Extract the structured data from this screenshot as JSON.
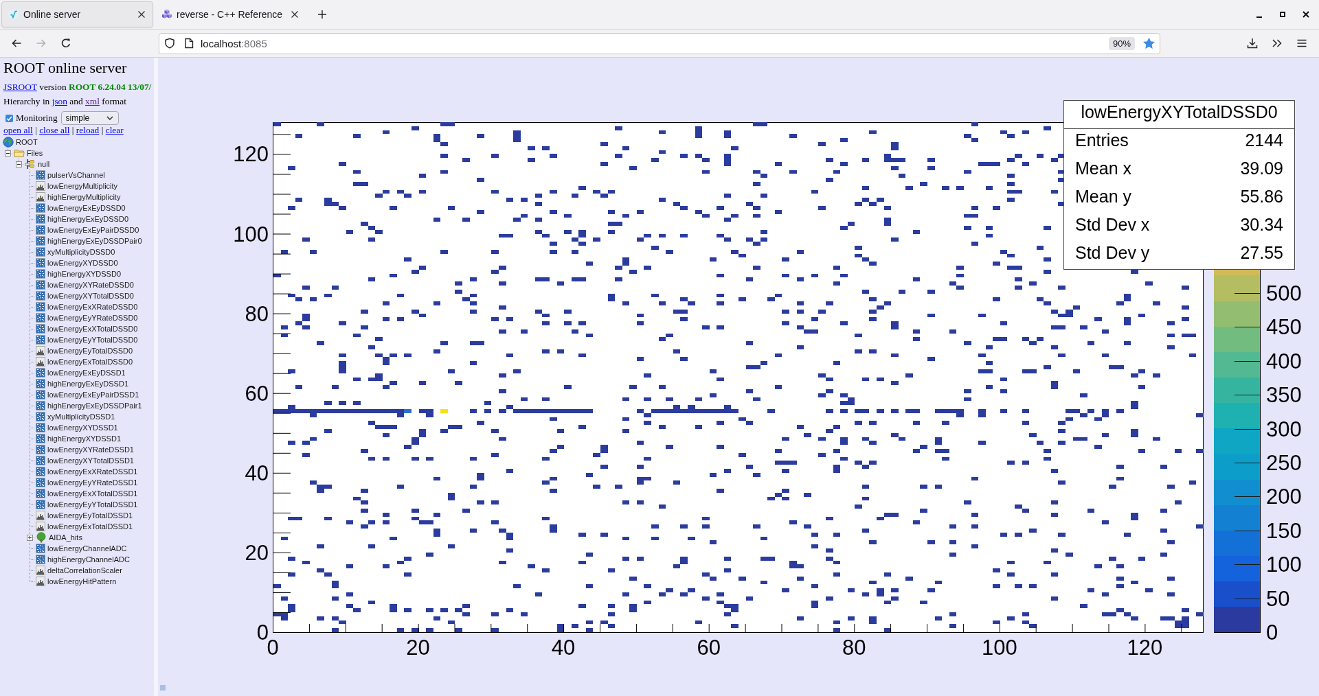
{
  "browser": {
    "tabs": [
      {
        "title": "Online server",
        "selected": true
      },
      {
        "title": "reverse - C++ Reference",
        "selected": false
      }
    ],
    "nav_buttons": [
      {
        "kind": "back",
        "disabled": false
      },
      {
        "kind": "forward",
        "disabled": true
      },
      {
        "kind": "reload",
        "disabled": false
      }
    ],
    "address_bar": {
      "host": "localhost",
      "port": ":8085",
      "zoom": "90%",
      "bookmarked": true
    }
  },
  "sidebar": {
    "title": "ROOT online server",
    "version_line": {
      "link": "JSROOT",
      "text": "version **ROOT 6.24.04 13/07/**"
    },
    "hierarchy_line": {
      "parts": [
        {
          "kind": "text",
          "text": "Hierarchy in"
        },
        {
          "kind": "link",
          "text": "json",
          "visited": false
        },
        {
          "kind": "text",
          "text": "and"
        },
        {
          "kind": "link",
          "text": "xml",
          "visited": true
        },
        {
          "kind": "text",
          "text": "format"
        }
      ]
    },
    "monitoring": {
      "label": "Monitoring",
      "checked": true,
      "mode": "simple"
    },
    "actions": {
      "links": [
        "open all",
        "close all",
        "reload",
        "clear"
      ],
      "separator": "|"
    },
    "tree": {
      "label": "ROOT",
      "kind": "root",
      "children": [
        {
          "label": "Files",
          "kind": "folder",
          "expanded": true,
          "children": [
            {
              "label": "null",
              "kind": "file",
              "expanded": true,
              "children": [
                {
                  "label": "pulserVsChannel",
                  "kind": "h2"
                },
                {
                  "label": "lowEnergyMultiplicity",
                  "kind": "h1"
                },
                {
                  "label": "highEnergyMultiplicity",
                  "kind": "h1"
                },
                {
                  "label": "lowEnergyExEyDSSD0",
                  "kind": "h2"
                },
                {
                  "label": "highEnergyExEyDSSD0",
                  "kind": "h2"
                },
                {
                  "label": "lowEnergyExEyPairDSSD0",
                  "kind": "h2"
                },
                {
                  "label": "highEnergyExEyDSSDPair0",
                  "kind": "h2"
                },
                {
                  "label": "xyMultiplicityDSSD0",
                  "kind": "h2"
                },
                {
                  "label": "lowEnergyXYDSSD0",
                  "kind": "h2"
                },
                {
                  "label": "highEnergyXYDSSD0",
                  "kind": "h2"
                },
                {
                  "label": "lowEnergyXYRateDSSD0",
                  "kind": "h2"
                },
                {
                  "label": "lowEnergyXYTotalDSSD0",
                  "kind": "h2"
                },
                {
                  "label": "lowEnergyExXRateDSSD0",
                  "kind": "h2"
                },
                {
                  "label": "lowEnergyEyYRateDSSD0",
                  "kind": "h2"
                },
                {
                  "label": "lowEnergyExXTotalDSSD0",
                  "kind": "h2"
                },
                {
                  "label": "lowEnergyEyYTotalDSSD0",
                  "kind": "h2"
                },
                {
                  "label": "lowEnergyEyTotalDSSD0",
                  "kind": "h1"
                },
                {
                  "label": "lowEnergyExTotalDSSD0",
                  "kind": "h1"
                },
                {
                  "label": "lowEnergyExEyDSSD1",
                  "kind": "h2"
                },
                {
                  "label": "highEnergyExEyDSSD1",
                  "kind": "h2"
                },
                {
                  "label": "lowEnergyExEyPairDSSD1",
                  "kind": "h2"
                },
                {
                  "label": "highEnergyExEyDSSDPair1",
                  "kind": "h2"
                },
                {
                  "label": "xyMultiplicityDSSD1",
                  "kind": "h2"
                },
                {
                  "label": "lowEnergyXYDSSD1",
                  "kind": "h2"
                },
                {
                  "label": "highEnergyXYDSSD1",
                  "kind": "h2"
                },
                {
                  "label": "lowEnergyXYRateDSSD1",
                  "kind": "h2"
                },
                {
                  "label": "lowEnergyXYTotalDSSD1",
                  "kind": "h2"
                },
                {
                  "label": "lowEnergyExXRateDSSD1",
                  "kind": "h2"
                },
                {
                  "label": "lowEnergyEyYRateDSSD1",
                  "kind": "h2"
                },
                {
                  "label": "lowEnergyExXTotalDSSD1",
                  "kind": "h2"
                },
                {
                  "label": "lowEnergyEyYTotalDSSD1",
                  "kind": "h2"
                },
                {
                  "label": "lowEnergyEyTotalDSSD1",
                  "kind": "h1"
                },
                {
                  "label": "lowEnergyExTotalDSSD1",
                  "kind": "h1"
                },
                {
                  "label": "AIDA_hits",
                  "kind": "tree",
                  "expanded": false
                },
                {
                  "label": "lowEnergyChannelADC",
                  "kind": "h2"
                },
                {
                  "label": "highEnergyChannelADC",
                  "kind": "h2"
                },
                {
                  "label": "deltaCorrelationScaler",
                  "kind": "h1"
                },
                {
                  "label": "lowEnergyHitPattern",
                  "kind": "h1"
                }
              ]
            }
          ]
        }
      ]
    }
  },
  "canvas": {
    "stats": {
      "title": "lowEnergyXYTotalDSSD0",
      "rows": [
        {
          "label": "Entries",
          "value": "2144"
        },
        {
          "label": "Mean x",
          "value": "39.09"
        },
        {
          "label": "Mean y",
          "value": "55.86"
        },
        {
          "label": "Std Dev x",
          "value": "30.34"
        },
        {
          "label": "Std Dev y",
          "value": "27.55"
        }
      ]
    },
    "x_axis": {
      "labels": [
        "0",
        "20",
        "40",
        "60",
        "80",
        "100",
        "120"
      ]
    },
    "y_axis": {
      "labels": [
        "120",
        "100",
        "80",
        "60",
        "40",
        "20",
        "0"
      ]
    },
    "palette": {
      "labels": [
        "500",
        "450",
        "400",
        "350",
        "300",
        "250",
        "200",
        "150",
        "100",
        "50",
        "0"
      ]
    }
  }
}
